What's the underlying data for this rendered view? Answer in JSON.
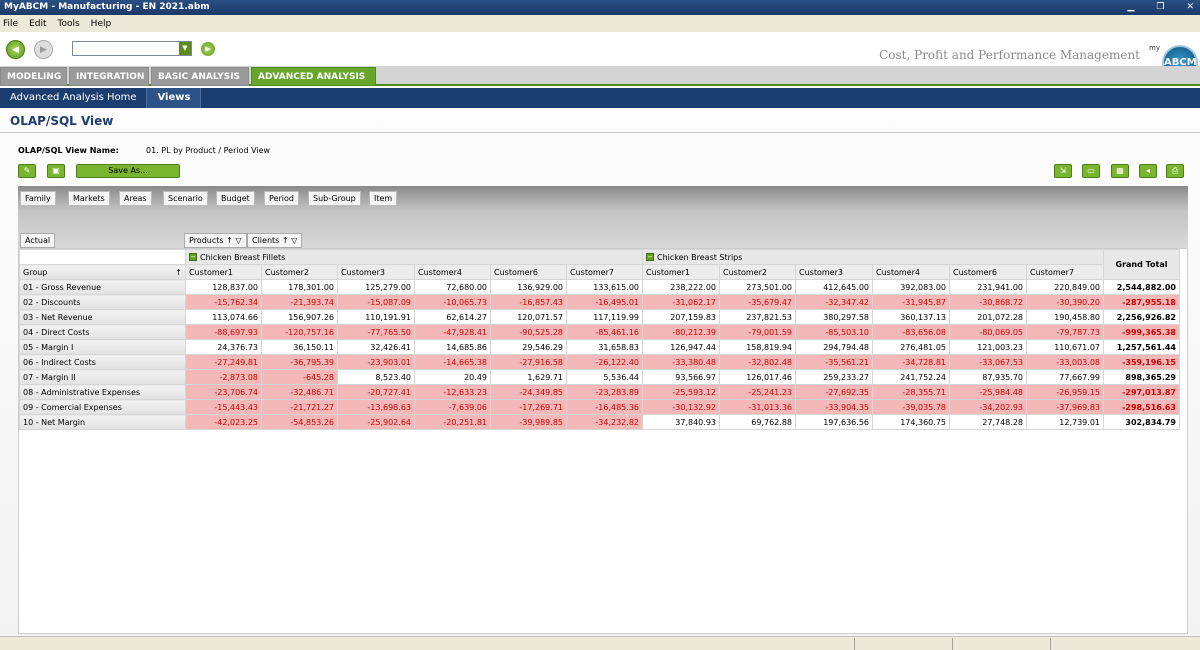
{
  "window": {
    "title": "MyABCM  - Manufacturing - EN 2021.abm"
  },
  "menu": [
    "File",
    "Edit",
    "Tools",
    "Help"
  ],
  "brand": {
    "tagline": "Cost, Profit and Performance Management",
    "logo_small": "my",
    "logo_text": "ABCM"
  },
  "tabs": [
    "MODELING",
    "INTEGRATION",
    "BASIC ANALYSIS",
    "ADVANCED ANALYSIS"
  ],
  "subnav": [
    "Advanced Analysis Home",
    "Views"
  ],
  "page": {
    "title": "OLAP/SQL View",
    "view_name_label": "OLAP/SQL View Name:",
    "view_name_value": "01. PL by Product / Period View",
    "save_as": "Save As..."
  },
  "dims": [
    "Family",
    "Markets",
    "Areas",
    "Scenario",
    "Budget",
    "Period",
    "Sub-Group",
    "Item"
  ],
  "filter": {
    "row_axis": "Actual",
    "col_axis_1": "Products",
    "col_axis_2": "Clients"
  },
  "grid": {
    "group_header": "Group",
    "grand_total_header": "Grand Total",
    "products": [
      "Chicken Breast Fillets",
      "Chicken Breast Strips"
    ],
    "customers": [
      "Customer1",
      "Customer2",
      "Customer3",
      "Customer4",
      "Customer6",
      "Customer7"
    ],
    "rows": [
      {
        "label": "01 - Gross Revenue",
        "values": [
          "128,837.00",
          "178,301.00",
          "125,279.00",
          "72,680.00",
          "136,929.00",
          "133,615.00",
          "238,222.00",
          "273,501.00",
          "412,645.00",
          "392,083.00",
          "231,941.00",
          "220,849.00"
        ],
        "total": "2,544,882.00",
        "neg": false
      },
      {
        "label": "02 - Discounts",
        "values": [
          "-15,762.34",
          "-21,393.74",
          "-15,087.09",
          "-10,065.73",
          "-16,857.43",
          "-16,495.01",
          "-31,062.17",
          "-35,679.47",
          "-32,347.42",
          "-31,945.87",
          "-30,868.72",
          "-30,390.20"
        ],
        "total": "-287,955.18",
        "neg": true
      },
      {
        "label": "03 - Net Revenue",
        "values": [
          "113,074.66",
          "156,907.26",
          "110,191.91",
          "62,614.27",
          "120,071.57",
          "117,119.99",
          "207,159.83",
          "237,821.53",
          "380,297.58",
          "360,137.13",
          "201,072.28",
          "190,458.80"
        ],
        "total": "2,256,926.82",
        "neg": false
      },
      {
        "label": "04 - Direct Costs",
        "values": [
          "-88,697.93",
          "-120,757.16",
          "-77,765.50",
          "-47,928.41",
          "-90,525.28",
          "-85,461.16",
          "-80,212.39",
          "-79,001.59",
          "-85,503.10",
          "-83,656.08",
          "-80,069.05",
          "-79,787.73"
        ],
        "total": "-999,365.38",
        "neg": true
      },
      {
        "label": "05 - Margin I",
        "values": [
          "24,376.73",
          "36,150.11",
          "32,426.41",
          "14,685.86",
          "29,546.29",
          "31,658.83",
          "126,947.44",
          "158,819.94",
          "294,794.48",
          "276,481.05",
          "121,003.23",
          "110,671.07"
        ],
        "total": "1,257,561.44",
        "neg": false
      },
      {
        "label": "06 - Indirect Costs",
        "values": [
          "-27,249.81",
          "-36,795.39",
          "-23,903.01",
          "-14,665.38",
          "-27,916.58",
          "-26,122.40",
          "-33,380.48",
          "-32,802.48",
          "-35,561.21",
          "-34,728.81",
          "-33,067.53",
          "-33,003.08"
        ],
        "total": "-359,196.15",
        "neg": true
      },
      {
        "label": "07 - Margin II",
        "values": [
          "-2,873.08",
          "-645.28",
          "8,523.40",
          "20.49",
          "1,629.71",
          "5,536.44",
          "93,566.97",
          "126,017.46",
          "259,233.27",
          "241,752.24",
          "87,935.70",
          "77,667.99"
        ],
        "total": "898,365.29",
        "neg": false,
        "negcells": [
          0,
          1
        ]
      },
      {
        "label": "08 - Administrative Expenses",
        "values": [
          "-23,706.74",
          "-32,486.71",
          "-20,727.41",
          "-12,633.23",
          "-24,349.85",
          "-23,283.89",
          "-25,593.12",
          "-25,241.23",
          "-27,692.35",
          "-28,355.71",
          "-25,984.48",
          "-26,959.15"
        ],
        "total": "-297,013.87",
        "neg": true
      },
      {
        "label": "09 - Comercial Expenses",
        "values": [
          "-15,443.43",
          "-21,721.27",
          "-13,698.63",
          "-7,639.06",
          "-17,269.71",
          "-16,485.36",
          "-30,132.92",
          "-31,013.36",
          "-33,904.35",
          "-39,035.78",
          "-34,202.93",
          "-37,969.83"
        ],
        "total": "-298,516.63",
        "neg": true
      },
      {
        "label": "10 - Net Margin",
        "values": [
          "-42,023.25",
          "-54,853.26",
          "-25,902.64",
          "-20,251.81",
          "-39,989.85",
          "-34,232.82",
          "37,840.93",
          "69,762.88",
          "197,636.56",
          "174,360.75",
          "27,748.28",
          "12,739.01"
        ],
        "total": "302,834.79",
        "neg": false,
        "negcells": [
          0,
          1,
          2,
          3,
          4,
          5
        ]
      }
    ]
  },
  "colors": {
    "accent_green": "#67a52b",
    "nav_blue": "#1c3d70",
    "neg_bg": "#f4b8b8",
    "neg_text": "#d00000"
  }
}
